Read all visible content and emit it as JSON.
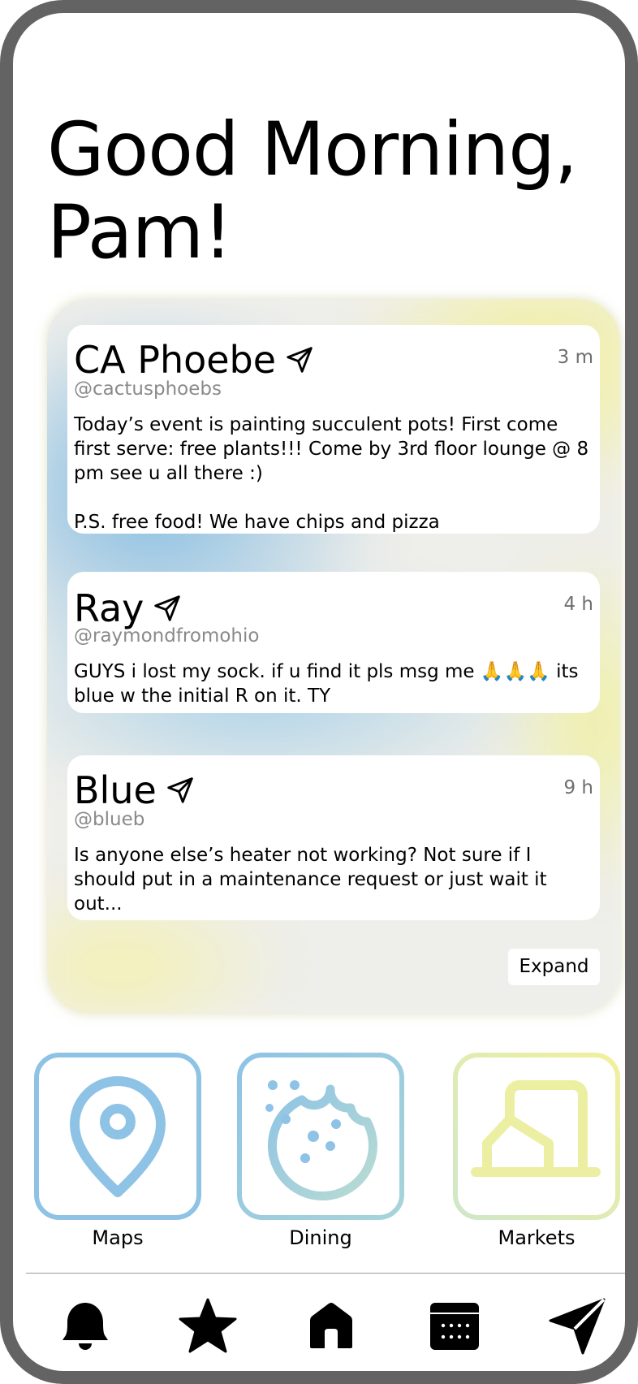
{
  "greeting": "Good Morning,\nPam!",
  "feed": {
    "posts": [
      {
        "name": "CA Phoebe",
        "handle": "@cactusphoebs",
        "time": "3 m",
        "body": "Today’s event is painting succulent pots! First come first serve: free plants!!! Come by 3rd floor lounge @ 8 pm see u all there :)\n\nP.S. free food! We have chips and pizza"
      },
      {
        "name": "Ray",
        "handle": "@raymondfromohio",
        "time": "4 h",
        "body": "GUYS i lost my sock. if u find it pls msg me 🙏🙏🙏 its blue w the initial R on it. TY"
      },
      {
        "name": "Blue",
        "handle": "@blueb",
        "time": "9 h",
        "body": "Is anyone else’s heater not working? Not sure if I should put in a maintenance request or just wait it out..."
      }
    ],
    "expand_label": "Expand"
  },
  "shortcuts": [
    {
      "label": "Maps",
      "icon": "map-pin-icon"
    },
    {
      "label": "Dining",
      "icon": "cookie-icon"
    },
    {
      "label": "Markets",
      "icon": "store-icon"
    }
  ],
  "nav": [
    {
      "icon": "bell-icon"
    },
    {
      "icon": "star-icon"
    },
    {
      "icon": "home-icon"
    },
    {
      "icon": "calendar-icon"
    },
    {
      "icon": "send-icon"
    }
  ],
  "colors": {
    "frame": "#636363",
    "accent_blue": "#8ec3e6",
    "accent_yellow": "#f1f09c",
    "muted_text": "#8a8a8a"
  }
}
